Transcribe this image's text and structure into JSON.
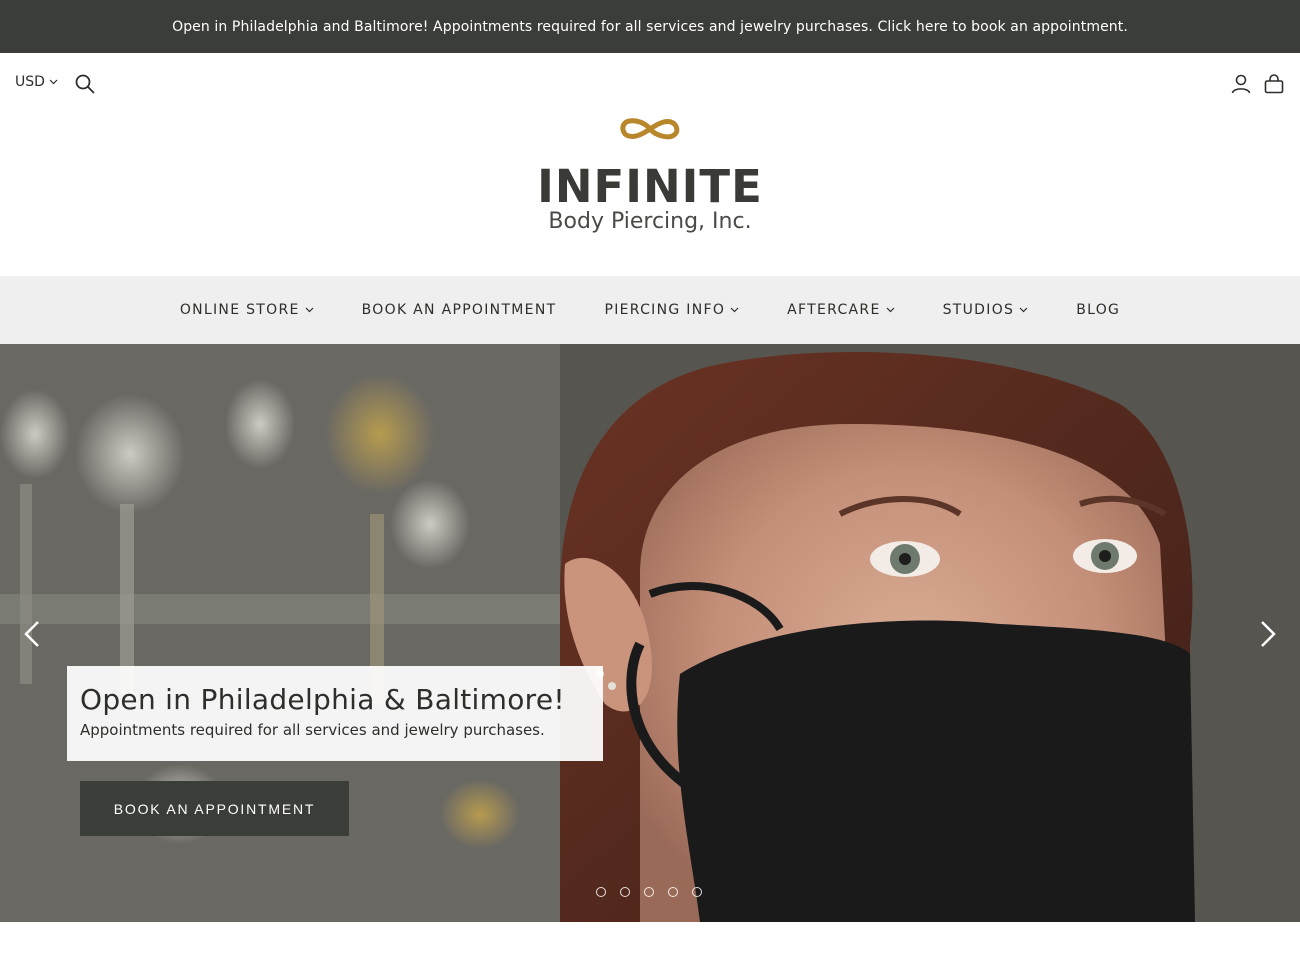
{
  "announcement": {
    "text": "Open in Philadelphia and Baltimore! Appointments required for all services and jewelry purchases. Click here to book an appointment."
  },
  "header": {
    "currency": "USD",
    "icons": [
      "search-icon",
      "account-icon",
      "cart-icon"
    ]
  },
  "logo": {
    "name": "INFINITE",
    "sub": "Body Piercing, Inc.",
    "mark_color": "#b8862b"
  },
  "nav": {
    "items": [
      {
        "label": "ONLINE STORE",
        "dropdown": true
      },
      {
        "label": "BOOK AN APPOINTMENT",
        "dropdown": false
      },
      {
        "label": "PIERCING INFO",
        "dropdown": true
      },
      {
        "label": "AFTERCARE",
        "dropdown": true
      },
      {
        "label": "STUDIOS",
        "dropdown": true
      },
      {
        "label": "BLOG",
        "dropdown": false
      }
    ]
  },
  "hero": {
    "title": "Open in Philadelphia & Baltimore!",
    "subtitle": "Appointments required for all services and jewelry purchases.",
    "button": "BOOK AN APPOINTMENT",
    "slides": 5
  },
  "colors": {
    "dark": "#3b3d38",
    "nav_bg": "#efefef",
    "accent_gold": "#b8862b"
  }
}
